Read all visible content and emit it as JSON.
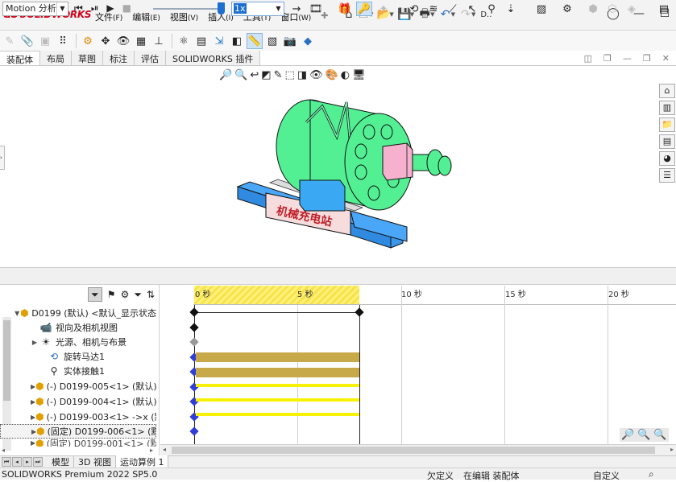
{
  "app": {
    "logo": "SOLIDWORKS",
    "menus": [
      {
        "label": "文件",
        "acc": "(F)"
      },
      {
        "label": "编辑",
        "acc": "(E)"
      },
      {
        "label": "视图",
        "acc": "(V)"
      },
      {
        "label": "插入",
        "acc": "(I)"
      },
      {
        "label": "工具",
        "acc": "(T)"
      },
      {
        "label": "窗口",
        "acc": "(W)"
      }
    ],
    "quick_more": "D.."
  },
  "tabs": [
    "装配体",
    "布局",
    "草图",
    "标注",
    "评估",
    "SOLIDWORKS 插件"
  ],
  "active_tab": "装配体",
  "viewport": {
    "model_label": "机械充电站",
    "colors": {
      "drum": "#52ef93",
      "base": "#4aa6f6",
      "block": "#f5b1ce",
      "plate": "#f6dcdc"
    }
  },
  "motion": {
    "study_type": "Motion 分析",
    "speed": "1x",
    "ruler": {
      "labels": [
        "0 秒",
        "5 秒",
        "10 秒",
        "15 秒",
        "20 秒"
      ]
    }
  },
  "tree": [
    {
      "text": "D0199 (默认) <默认_显示状态",
      "expand": "▼",
      "icon": "assembly-icon"
    },
    {
      "text": "视向及相机视图",
      "expand": "",
      "icon": "camera-icon"
    },
    {
      "text": "光源、相机与布景",
      "expand": "▶",
      "icon": "lights-icon"
    },
    {
      "text": "旋转马达1",
      "expand": "",
      "icon": "motor-icon"
    },
    {
      "text": "实体接触1",
      "expand": "",
      "icon": "contact-icon"
    },
    {
      "text": "(-) D0199-005<1> (默认)",
      "expand": "▶",
      "icon": "part-icon"
    },
    {
      "text": "(-) D0199-004<1> (默认)",
      "expand": "▶",
      "icon": "part-icon"
    },
    {
      "text": "(-) D0199-003<1> ->x (默",
      "expand": "▶",
      "icon": "part-icon"
    },
    {
      "text": "(固定) D0199-006<1> (默",
      "expand": "▶",
      "icon": "part-icon"
    },
    {
      "text": "(固定) D0199-001<1> (默",
      "expand": "▶",
      "icon": "part-icon"
    }
  ],
  "bottom_tabs": [
    "模型",
    "3D 视图",
    "运动算例 1"
  ],
  "active_bottom_tab": "运动算例 1",
  "status": {
    "product": "SOLIDWORKS Premium 2022 SP5.0",
    "under_defined": "欠定义",
    "editing": "在编辑 装配体",
    "units": "自定义"
  },
  "colors": {
    "bar_gold": "#c8a94a",
    "bar_yellow": "#f7f107",
    "key_blue": "#2f3fd6",
    "key_black": "#111111",
    "hatch": "#fff27a"
  }
}
